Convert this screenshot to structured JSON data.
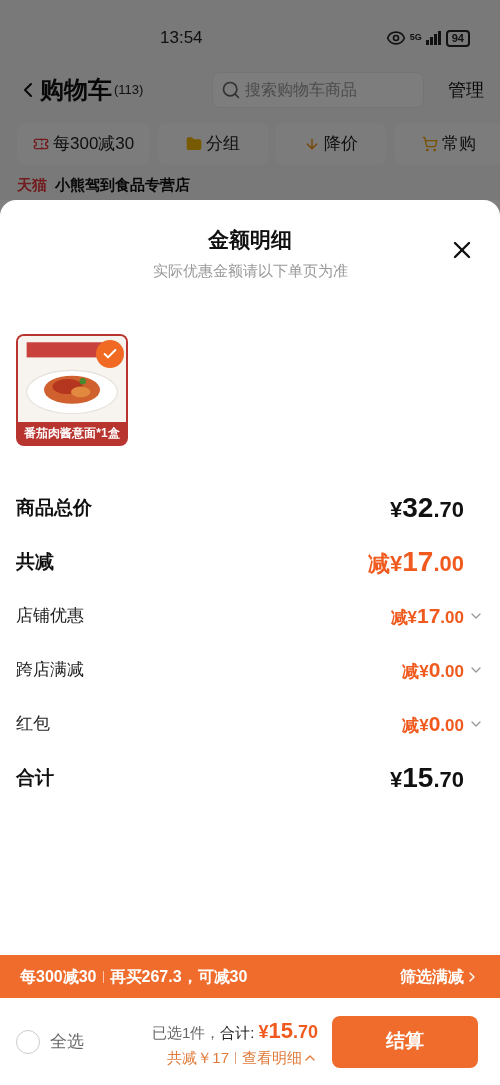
{
  "status_bar": {
    "time": "13:54",
    "battery": "94",
    "network": "5G"
  },
  "header": {
    "title": "购物车",
    "count": "(113)",
    "search": {
      "placeholder": "搜索购物车商品"
    },
    "manage": "管理"
  },
  "chips": [
    {
      "label": "每300减30",
      "kind": "promo"
    },
    {
      "label": "分组",
      "kind": "folder"
    },
    {
      "label": "降价",
      "kind": "down"
    },
    {
      "label": "常购",
      "kind": "cart"
    }
  ],
  "shop": {
    "badge": "天猫",
    "name": "小熊驾到食品专营店"
  },
  "sheet": {
    "title": "金额明细",
    "subtitle": "实际优惠金额请以下单页为准",
    "products": [
      {
        "caption": "番茄肉酱意面*1盒",
        "selected": true
      }
    ],
    "rows": [
      {
        "kind": "total",
        "label": "商品总价",
        "prefix": "",
        "symbol": "¥",
        "whole": "32",
        "fraction": ".70"
      },
      {
        "kind": "discount",
        "label": "共减",
        "prefix": "减",
        "symbol": "¥",
        "whole": "17",
        "fraction": ".00"
      },
      {
        "kind": "detail",
        "label": "店铺优惠",
        "prefix": "减",
        "symbol": "¥",
        "whole": "17",
        "fraction": ".00",
        "expanded": false
      },
      {
        "kind": "detail",
        "label": "跨店满减",
        "prefix": "减",
        "symbol": "¥",
        "whole": "0",
        "fraction": ".00",
        "expanded": false
      },
      {
        "kind": "detail",
        "label": "红包",
        "prefix": "减",
        "symbol": "¥",
        "whole": "0",
        "fraction": ".00",
        "expanded": false
      },
      {
        "kind": "total",
        "label": "合计",
        "prefix": "",
        "symbol": "¥",
        "whole": "15",
        "fraction": ".70"
      }
    ]
  },
  "promo_bar": {
    "rule": "每300减30",
    "hint": "再买267.3，可减30",
    "link": "筛选满减"
  },
  "footer": {
    "select_all": {
      "label": "全选",
      "checked": false
    },
    "selected_count": "已选1件，",
    "total_label": "合计:",
    "total": {
      "symbol": "¥",
      "whole": "15",
      "fraction": ".70"
    },
    "saved": "共减￥17",
    "details": "查看明细",
    "details_expanded": true,
    "checkout": "结算"
  }
}
